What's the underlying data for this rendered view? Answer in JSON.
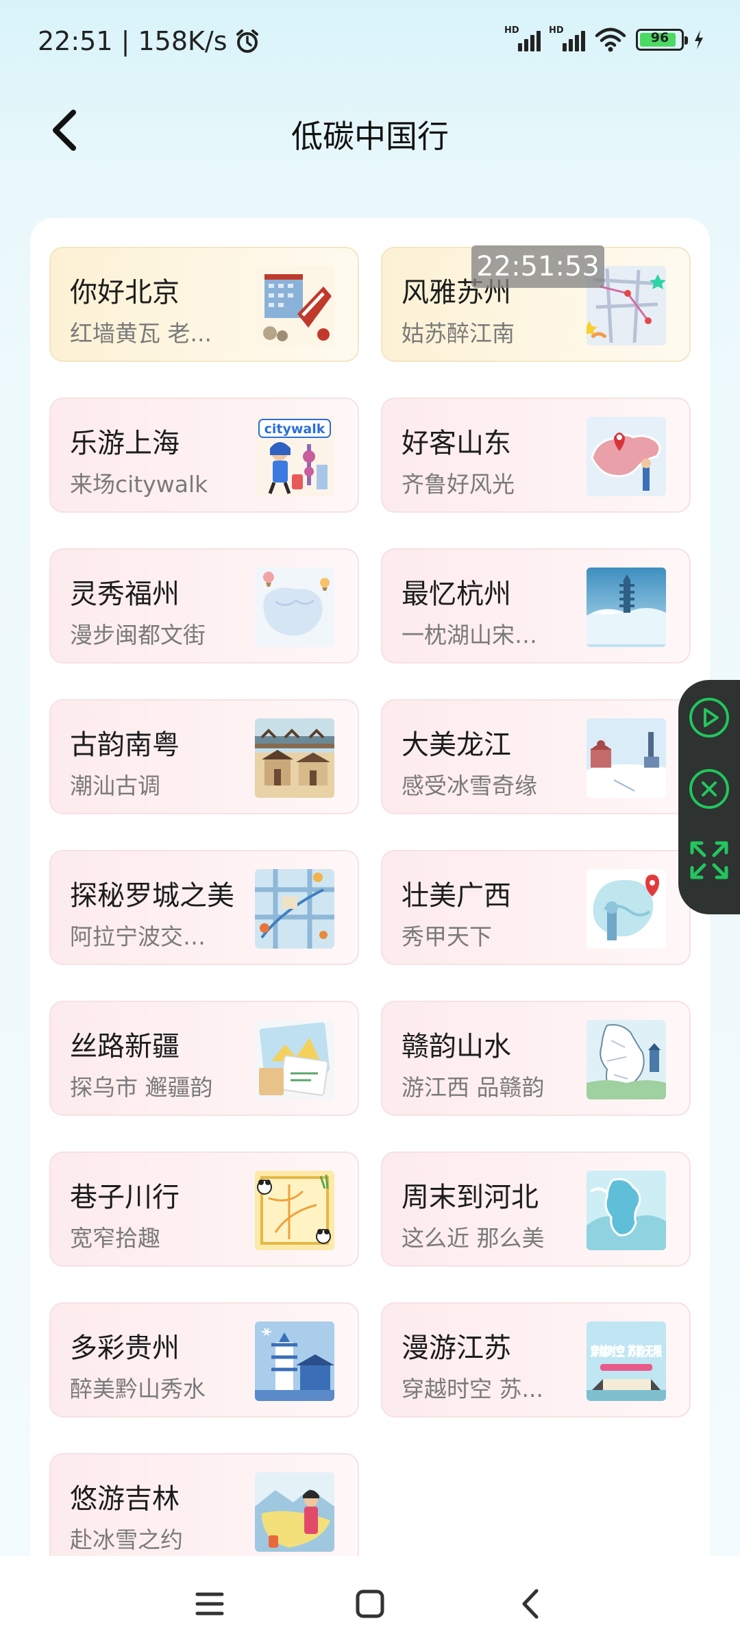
{
  "status": {
    "time_speed": "22:51 | 158K/s",
    "battery": "96"
  },
  "header": {
    "title": "低碳中国行"
  },
  "overlay_time": "22:51:53",
  "cards": [
    {
      "title": "你好北京",
      "subtitle": "红墙黄瓦 老...",
      "thumb": "beijing-illustration-icon"
    },
    {
      "title": "风雅苏州",
      "subtitle": "姑苏醉江南",
      "thumb": "suzhou-map-icon"
    },
    {
      "title": "乐游上海",
      "subtitle": "来场citywalk",
      "thumb": "shanghai-citywalk-icon",
      "thumb_text": "citywalk"
    },
    {
      "title": "好客山东",
      "subtitle": "齐鲁好风光",
      "thumb": "shandong-map-icon"
    },
    {
      "title": "灵秀福州",
      "subtitle": "漫步闽都文街",
      "thumb": "fuzhou-map-icon"
    },
    {
      "title": "最忆杭州",
      "subtitle": "一枕湖山宋时梦",
      "thumb": "hangzhou-pagoda-icon"
    },
    {
      "title": "古韵南粤",
      "subtitle": "潮汕古调",
      "thumb": "chaoshan-bridge-icon"
    },
    {
      "title": "大美龙江",
      "subtitle": "感受冰雪奇缘",
      "thumb": "longjiang-snow-icon"
    },
    {
      "title": "探秘罗城之美",
      "subtitle": "阿拉宁波交关赞",
      "thumb": "ningbo-map-icon"
    },
    {
      "title": "壮美广西",
      "subtitle": "秀甲天下",
      "thumb": "guangxi-map-icon"
    },
    {
      "title": "丝路新疆",
      "subtitle": "探乌市 邂疆韵",
      "thumb": "xinjiang-postcard-icon"
    },
    {
      "title": "赣韵山水",
      "subtitle": "游江西 品赣韵",
      "thumb": "jiangxi-map-icon"
    },
    {
      "title": "巷子川行",
      "subtitle": "宽窄拾趣",
      "thumb": "sichuan-panda-map-icon"
    },
    {
      "title": "周末到河北",
      "subtitle": "这么近 那么美",
      "thumb": "hebei-map-icon"
    },
    {
      "title": "多彩贵州",
      "subtitle": "醉美黔山秀水",
      "thumb": "guizhou-illustration-icon"
    },
    {
      "title": "漫游江苏",
      "subtitle": "穿越时空 苏...",
      "thumb": "jiangsu-poster-icon",
      "thumb_text": "穿越时空 苏韵无限"
    },
    {
      "title": "悠游吉林",
      "subtitle": "赴冰雪之约",
      "thumb": "jilin-illustration-icon"
    }
  ]
}
